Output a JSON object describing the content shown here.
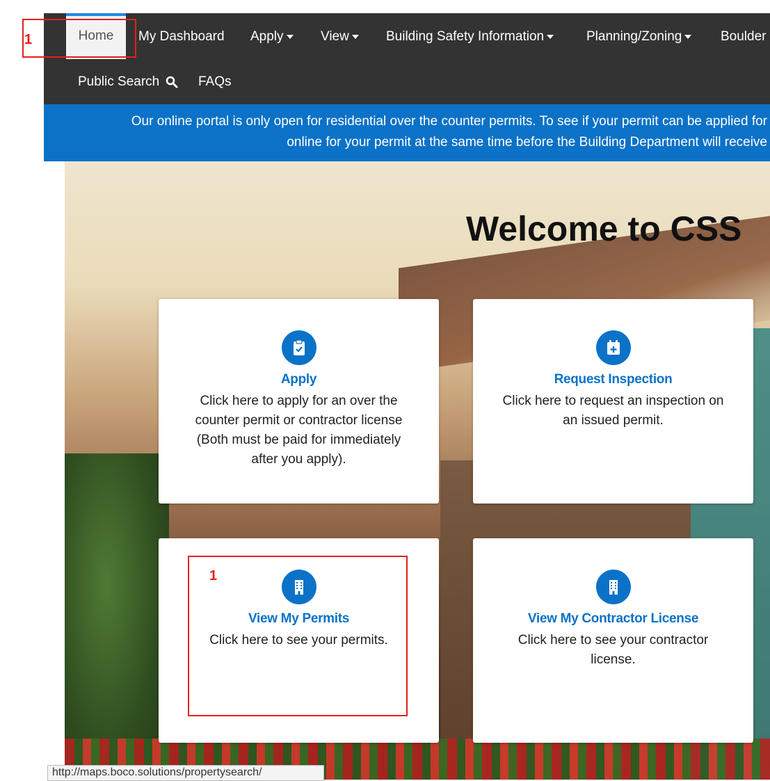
{
  "nav": {
    "home": "Home",
    "dashboard": "My Dashboard",
    "apply": "Apply",
    "view": "View",
    "building_safety": "Building Safety Information",
    "planning": "Planning/Zoning",
    "boulder": "Boulder",
    "public_search": "Public Search",
    "faqs": "FAQs"
  },
  "banner": {
    "line1": "Our online portal is only open for residential over the counter permits. To see if your permit can be applied for",
    "line2": "online for your permit at the same time before the Building Department will receive"
  },
  "hero": {
    "welcome": "Welcome to CSS"
  },
  "cards": [
    {
      "title": "Apply",
      "desc": "Click here to apply for an over the counter permit or contractor license (Both must be paid for immediately after you apply).",
      "icon": "clipboard-check-icon"
    },
    {
      "title": "Request Inspection",
      "desc": "Click here to request an inspection on an issued permit.",
      "icon": "calendar-plus-icon"
    },
    {
      "title": "View My Permits",
      "desc": "Click here to see your permits.",
      "icon": "building-icon"
    },
    {
      "title": "View My Contractor License",
      "desc": "Click here to see your contractor license.",
      "icon": "building-icon"
    }
  ],
  "annotations": {
    "home_marker": "1",
    "permits_marker": "1"
  },
  "statusbar": {
    "url": "http://maps.boco.solutions/propertysearch/"
  },
  "colors": {
    "accent": "#0b72c8",
    "nav_bg": "#333333",
    "annotation": "#e3201b"
  }
}
